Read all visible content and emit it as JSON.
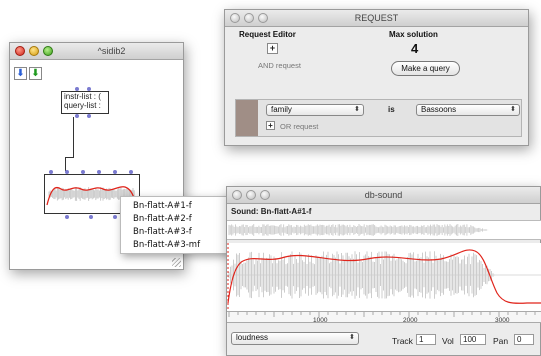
{
  "patch_window": {
    "title": "^sidib2",
    "box_lines": [
      "instr-list : (",
      "query-list :"
    ],
    "popup_items": [
      "Bn-flatt-A#1-f",
      "Bn-flatt-A#2-f",
      "Bn-flatt-A#3-f",
      "Bn-flatt-A#3-mf"
    ]
  },
  "request_window": {
    "title": "REQUEST",
    "editor_label": "Request Editor",
    "max_solution_label": "Max solution",
    "max_solution_value": "4",
    "and_request_label": "AND request",
    "make_query_label": "Make a query",
    "field_select": "family",
    "operator_label": "is",
    "value_select": "Bassoons",
    "or_request_label": "OR request"
  },
  "db_sound_window": {
    "title": "db-sound",
    "sound_label": "Sound: Bn-flatt-A#1-f",
    "ruler_ticks": [
      "1000",
      "2000",
      "3000"
    ],
    "descriptor_select": "loudness",
    "track_label": "Track",
    "track_value": "1",
    "vol_label": "Vol",
    "vol_value": "100",
    "pan_label": "Pan",
    "pan_value": "0"
  },
  "colors": {
    "envelope": "#e0241b",
    "inlet": "#7b7bd0",
    "swatch": "#a08e86"
  }
}
